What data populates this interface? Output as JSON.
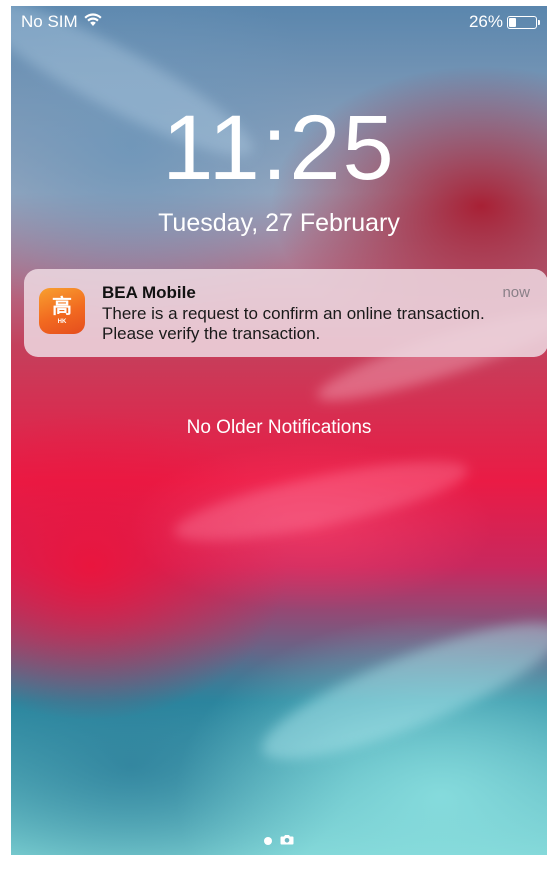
{
  "status_bar": {
    "carrier": "No SIM",
    "battery_percent_label": "26%",
    "battery_level": 0.26,
    "wifi_icon": "wifi-icon",
    "battery_icon": "battery-icon"
  },
  "lock_screen": {
    "time": "11:25",
    "date": "Tuesday, 27 February"
  },
  "notification": {
    "app_name": "BEA Mobile",
    "time": "now",
    "body": "There is a request to confirm an online transaction. Please verify the transaction.",
    "app_icon": "bea-app-icon",
    "app_icon_text": "HK"
  },
  "notification_center": {
    "no_older_label": "No Older Notifications"
  },
  "page_indicator": {
    "current_page_icon": "page-dot-icon",
    "camera_icon": "camera-icon"
  },
  "colors": {
    "text": "#ffffff",
    "notification_bg": "#eedae2",
    "app_icon_orange": "#f26a20"
  }
}
